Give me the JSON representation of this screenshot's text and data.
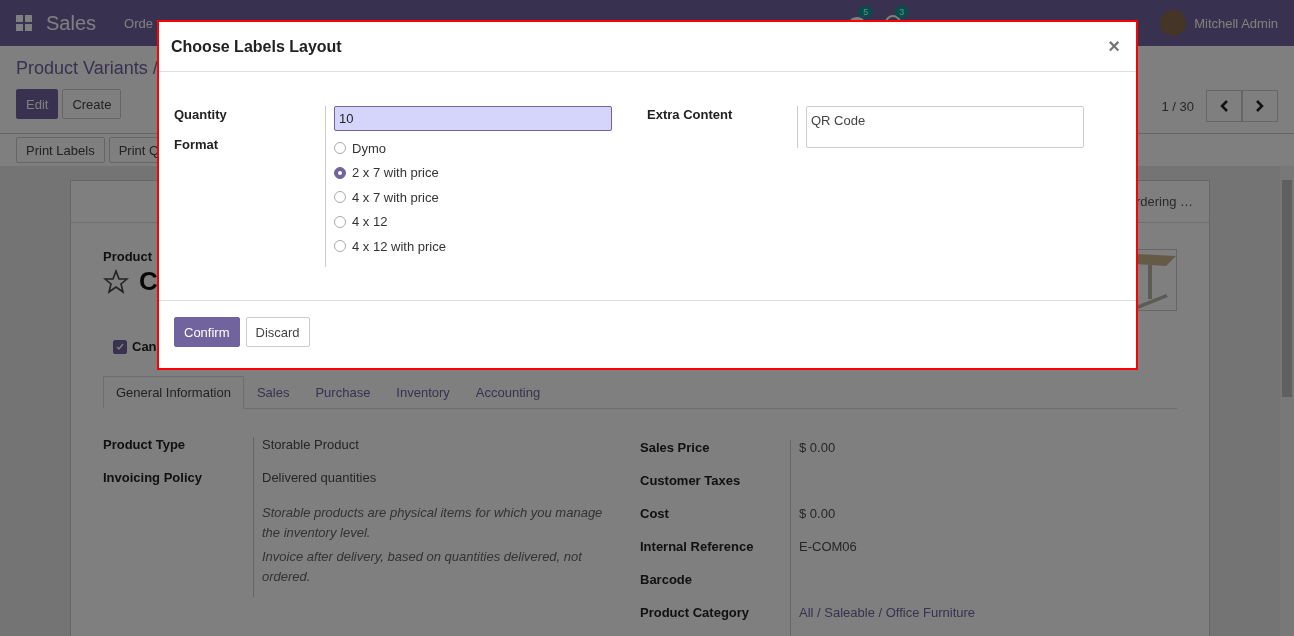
{
  "navbar": {
    "app": "Sales",
    "menu": [
      "Orde"
    ],
    "chat_badge": "5",
    "activity_badge": "3",
    "user": "Mitchell Admin"
  },
  "breadcrumb": "Product Variants /",
  "actions": [
    "Edit",
    "Create"
  ],
  "pager": "1 / 30",
  "print_buttons": [
    "Print Labels",
    "Print Q"
  ],
  "sheet": {
    "smart_button": "rdering …",
    "title_label": "Product",
    "title": "C",
    "can_be_sold": {
      "label": "Can",
      "checked": true
    },
    "tabs": [
      {
        "label": "General Information",
        "selected": true
      },
      {
        "label": "Sales",
        "selected": false
      },
      {
        "label": "Purchase",
        "selected": false
      },
      {
        "label": "Inventory",
        "selected": false
      },
      {
        "label": "Accounting",
        "selected": false
      }
    ],
    "left_fields": [
      {
        "label": "Product Type",
        "value": "Storable Product"
      },
      {
        "label": "Invoicing Policy",
        "value": "Delivered quantities"
      }
    ],
    "notes": [
      "Storable products are physical items for which you manage the inventory level.",
      "Invoice after delivery, based on quantities delivered, not ordered."
    ],
    "right_fields": [
      {
        "label": "Sales Price",
        "kind": "text",
        "value": "$ 0.00"
      },
      {
        "label": "Customer Taxes",
        "kind": "empty"
      },
      {
        "label": "Cost",
        "kind": "text",
        "value": "$ 0.00"
      },
      {
        "label": "Internal Reference",
        "kind": "text",
        "value": "E-COM06"
      },
      {
        "label": "Barcode",
        "kind": "empty"
      },
      {
        "label": "Product Category",
        "kind": "link",
        "value": "All / Saleable / Office Furniture"
      }
    ]
  },
  "dialog": {
    "title": "Choose Labels Layout",
    "close": "×",
    "quantity": {
      "label": "Quantity",
      "value": "10"
    },
    "format": {
      "label": "Format",
      "options": [
        {
          "label": "Dymo",
          "selected": false
        },
        {
          "label": "2 x 7 with price",
          "selected": true
        },
        {
          "label": "4 x 7 with price",
          "selected": false
        },
        {
          "label": "4 x 12",
          "selected": false
        },
        {
          "label": "4 x 12 with price",
          "selected": false
        }
      ]
    },
    "extra_content": {
      "label": "Extra Content",
      "value": "QR Code"
    },
    "buttons": [
      "Confirm",
      "Discard"
    ]
  }
}
